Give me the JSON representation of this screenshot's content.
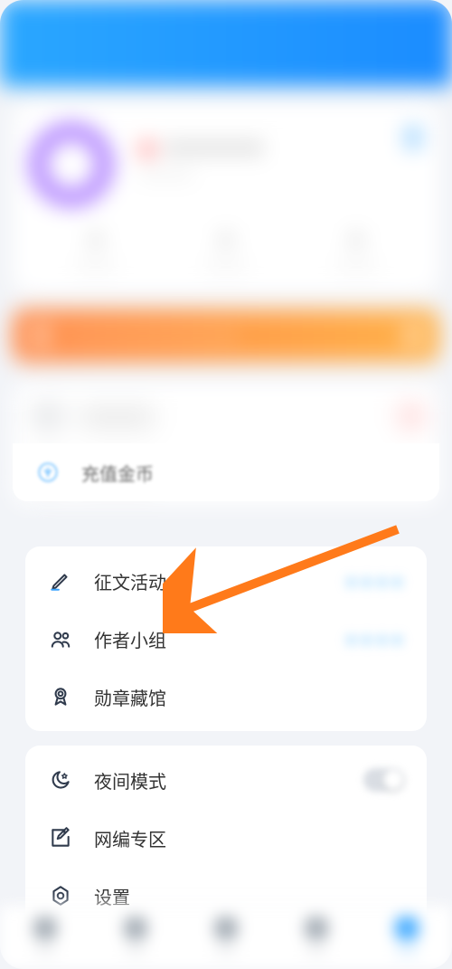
{
  "card2_top": {
    "item3": {
      "label": "充值金币"
    }
  },
  "card2_clear": {
    "item1": {
      "label": "征文活动"
    },
    "item2": {
      "label": "作者小组"
    },
    "item3": {
      "label": "勋章藏馆"
    }
  },
  "card3": {
    "item1": {
      "label": "夜间模式"
    },
    "item2": {
      "label": "网编专区"
    },
    "item3": {
      "label": "设置"
    }
  }
}
